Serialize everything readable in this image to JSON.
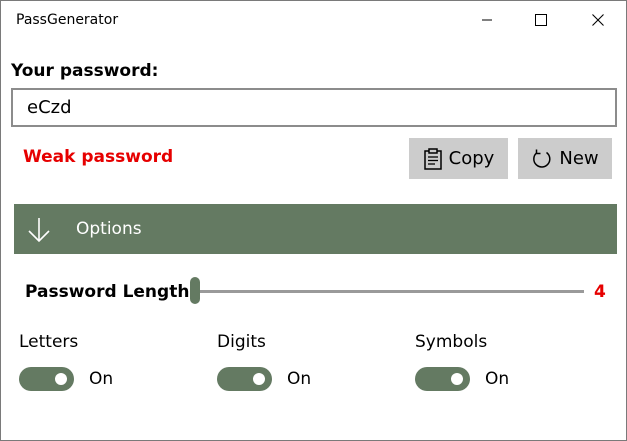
{
  "window": {
    "title": "PassGenerator",
    "controls": [
      "minimize-icon",
      "maximize-icon",
      "close-icon"
    ]
  },
  "password": {
    "label": "Your password:",
    "value": "eCzd",
    "strength_text": "Weak password"
  },
  "actions": {
    "copy_label": "Copy",
    "copy_icon": "clipboard-icon",
    "new_label": "New",
    "new_icon": "refresh-icon"
  },
  "options": {
    "label": "Options",
    "icon": "arrow-down-icon",
    "length_label": "Password Length:",
    "length_value": "4",
    "length_fraction": 0.0,
    "toggles": [
      {
        "label": "Letters",
        "state": "On",
        "on": true
      },
      {
        "label": "Digits",
        "state": "On",
        "on": true
      },
      {
        "label": "Symbols",
        "state": "On",
        "on": true
      }
    ]
  },
  "colors": {
    "accent": "#647a62",
    "warning": "#e60000",
    "button_bg": "#cccccc"
  }
}
